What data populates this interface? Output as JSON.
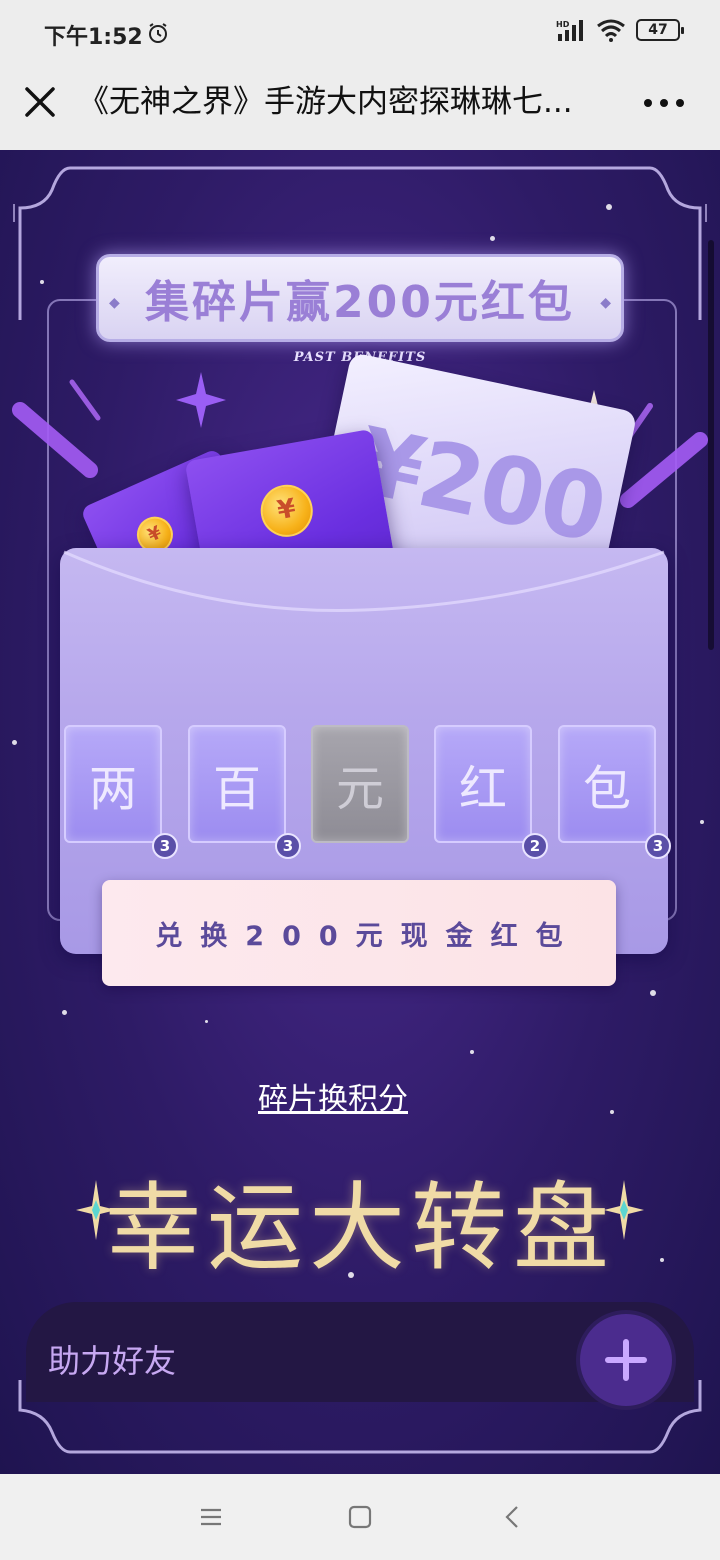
{
  "status_bar": {
    "time": "下午1:52",
    "network_label": "HD",
    "battery": "47"
  },
  "title_bar": {
    "title": "《无神之界》手游大内密探琳琳七..."
  },
  "page": {
    "banner_title": "集碎片赢200元红包",
    "banner_subtitle": "PAST BENEFITS",
    "cash_amount": "¥200",
    "coin_symbol": "¥",
    "fragments": [
      {
        "char": "两",
        "count": "3",
        "collected": true
      },
      {
        "char": "百",
        "count": "3",
        "collected": true
      },
      {
        "char": "元",
        "count": "",
        "collected": false
      },
      {
        "char": "红",
        "count": "2",
        "collected": true
      },
      {
        "char": "包",
        "count": "3",
        "collected": true
      }
    ],
    "exchange_button": "兑换200元现金红包",
    "points_link": "碎片换积分",
    "wheel_title": "幸运大转盘",
    "help_label": "助力好友"
  },
  "colors": {
    "bg_purple": "#2e1b66",
    "tile_purple": "#9c8cf0",
    "exchange_pink": "#fce3e6",
    "gold": "#f0dba6"
  },
  "icons": [
    "alarm-icon",
    "signal-icon",
    "wifi-icon",
    "battery-icon",
    "close-icon",
    "more-icon",
    "plus-icon",
    "menu-nav-icon",
    "home-nav-icon",
    "back-nav-icon"
  ]
}
